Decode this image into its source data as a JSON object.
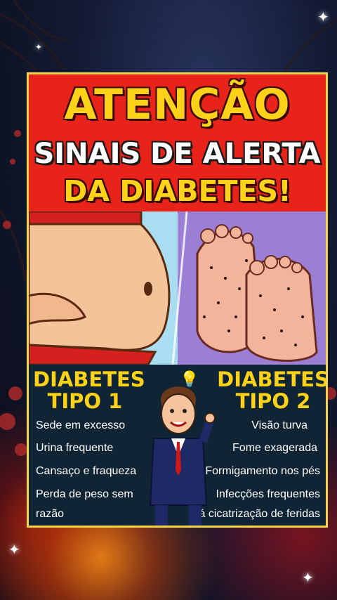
{
  "headline": {
    "line1": "ATENÇÃO",
    "line2": "SINAIS DE ALERTA",
    "line3": "DA DIABETES!"
  },
  "type1": {
    "title_line1": "DIABETES",
    "title_line2": "TIPO 1",
    "items": [
      "Sede em excesso",
      "Urina frequente",
      "Cansaço e fraqueza",
      "Perda de peso sem",
      "razão"
    ]
  },
  "type2": {
    "title_line1": "DIABETES",
    "title_line2": "TIPO 2",
    "items": [
      "Visão turva",
      "Fome exagerada",
      "Formigamento nos pés",
      "Infecções frequentes",
      "Má cicatrização de feridas"
    ]
  },
  "colors": {
    "card_red": "#e8231a",
    "headline_yellow": "#ffd21a",
    "info_panel": "#0f2535"
  },
  "icons": [
    "lightbulb-icon",
    "sparkle-icon"
  ]
}
